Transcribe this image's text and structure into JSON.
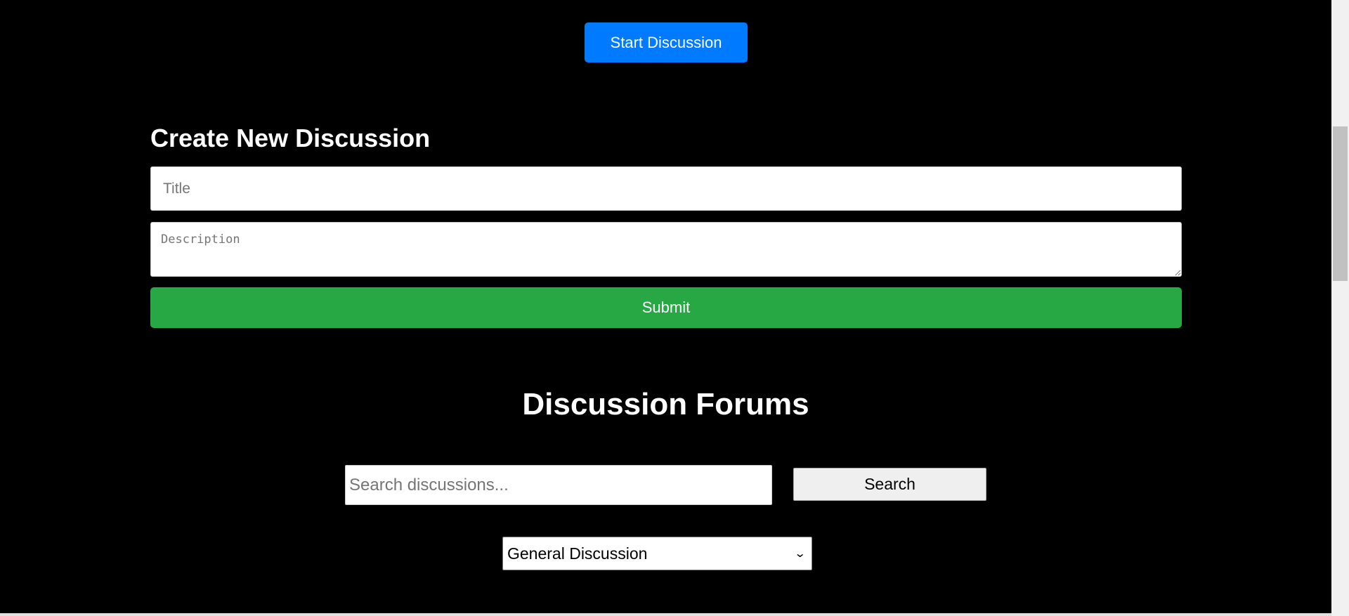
{
  "hero": {
    "start_button_label": "Start Discussion"
  },
  "create_form": {
    "heading": "Create New Discussion",
    "title_placeholder": "Title",
    "description_placeholder": "Description",
    "submit_label": "Submit"
  },
  "forums": {
    "heading": "Discussion Forums",
    "search_placeholder": "Search discussions...",
    "search_button_label": "Search",
    "selected_category": "General Discussion"
  },
  "colors": {
    "primary": "#007bff",
    "success": "#28a745",
    "background": "#000000"
  },
  "icons": {
    "select_chevron": "chevron-down-icon"
  }
}
